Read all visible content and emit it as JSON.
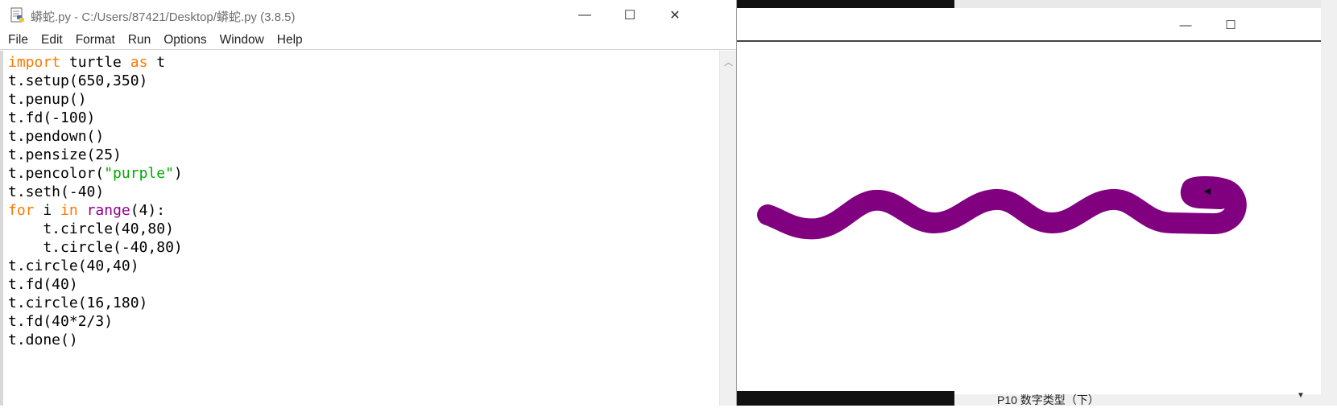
{
  "editor": {
    "title": "蟒蛇.py - C:/Users/87421/Desktop/蟒蛇.py (3.8.5)",
    "menu": [
      "File",
      "Edit",
      "Format",
      "Run",
      "Options",
      "Window",
      "Help"
    ],
    "code_lines": [
      "import turtle as t",
      "t.setup(650,350)",
      "t.penup()",
      "t.fd(-100)",
      "t.pendown()",
      "t.pensize(25)",
      "t.pencolor(\"purple\")",
      "t.seth(-40)",
      "for i in range(4):",
      "    t.circle(40,80)",
      "    t.circle(-40,80)",
      "t.circle(40,40)",
      "t.fd(40)",
      "t.circle(16,180)",
      "t.fd(40*2/3)",
      "t.done()"
    ],
    "controls": {
      "minimize": "—",
      "maximize": "☐",
      "close": "✕"
    }
  },
  "turtle_window": {
    "controls": {
      "minimize": "—",
      "maximize": "☐"
    },
    "snake_color": "#800080"
  },
  "status_bar": {
    "text": "P10   数字类型（下）"
  },
  "icons": [
    "python-file-icon",
    "minimize-icon",
    "maximize-icon",
    "close-icon",
    "scroll-up-arrow-icon"
  ]
}
